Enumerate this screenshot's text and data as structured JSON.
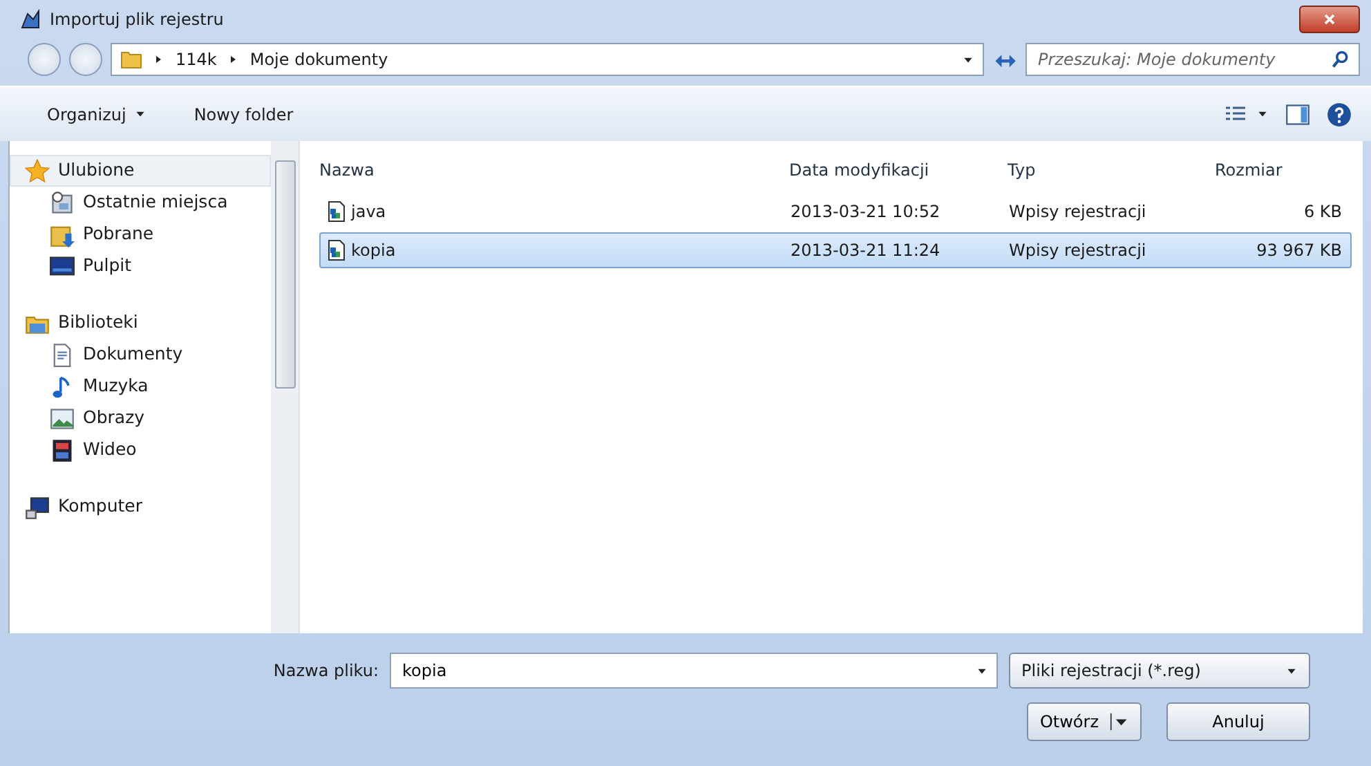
{
  "window": {
    "title": "Importuj plik rejestru"
  },
  "address": {
    "path": [
      "114k",
      "Moje dokumenty"
    ],
    "search_placeholder": "Przeszukaj: Moje dokumenty"
  },
  "toolbar": {
    "organize": "Organizuj",
    "new_folder": "Nowy folder"
  },
  "sidebar": {
    "items": [
      {
        "kind": "header",
        "label": "Ulubione",
        "selected": true
      },
      {
        "kind": "item",
        "label": "Ostatnie miejsca",
        "selected": false
      },
      {
        "kind": "item",
        "label": "Pobrane",
        "selected": false
      },
      {
        "kind": "item",
        "label": "Pulpit",
        "selected": false
      },
      {
        "kind": "header",
        "label": "Biblioteki",
        "selected": false
      },
      {
        "kind": "item",
        "label": "Dokumenty",
        "selected": false
      },
      {
        "kind": "item",
        "label": "Muzyka",
        "selected": false
      },
      {
        "kind": "item",
        "label": "Obrazy",
        "selected": false
      },
      {
        "kind": "item",
        "label": "Wideo",
        "selected": false
      },
      {
        "kind": "header",
        "label": "Komputer",
        "selected": false
      }
    ]
  },
  "table": {
    "columns": [
      "Nazwa",
      "Data modyfikacji",
      "Typ",
      "Rozmiar"
    ],
    "rows": [
      {
        "name": "java",
        "date": "2013-03-21 10:52",
        "type": "Wpisy rejestracji",
        "size": "6 KB",
        "selected": false
      },
      {
        "name": "kopia",
        "date": "2013-03-21 11:24",
        "type": "Wpisy rejestracji",
        "size": "93 967 KB",
        "selected": true
      }
    ]
  },
  "footer": {
    "filename_label": "Nazwa pliku:",
    "filename": "kopia",
    "filter": "Pliki rejestracji (*.reg)",
    "open": "Otwórz",
    "cancel": "Anuluj"
  }
}
